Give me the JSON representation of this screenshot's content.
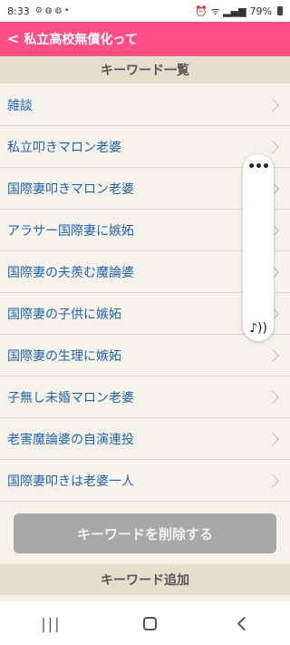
{
  "status_bar": {
    "time": "8:33",
    "battery": "79%",
    "left_icons": "⚙ ◍ ◍ •",
    "right_icons": "⏰ ᯤ ▂▄▆"
  },
  "header": {
    "back_glyph": "<",
    "title": "私立高校無償化って"
  },
  "keyword_section": {
    "title": "キーワード一覧",
    "items": [
      "雑談",
      "私立叩きマロン老婆",
      "国際妻叩きマロン老婆",
      "アラサー国際妻に嫉妬",
      "国際妻の夫羨む魔論婆",
      "国際妻の子供に嫉妬",
      "国際妻の生理に嫉妬",
      "子無し未婚マロン老婆",
      "老害魔論婆の自演連投",
      "国際妻叩きは老婆一人"
    ]
  },
  "delete_button": {
    "label": "キーワードを削除する"
  },
  "add_section": {
    "title": "キーワード追加"
  },
  "floating_panel": {
    "more_glyph": "•••",
    "sound_glyph": "♪))"
  },
  "nav_bar": {
    "recents_glyph": "|||"
  }
}
